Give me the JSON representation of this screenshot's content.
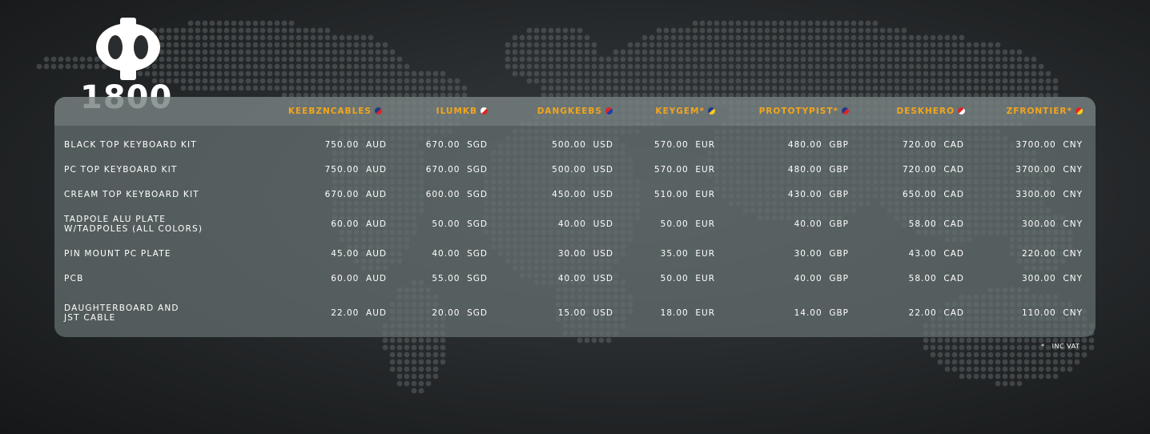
{
  "logo": {
    "symbol": "Φ",
    "model": "1800"
  },
  "vendors": [
    {
      "name": "KEEBZNCABLES",
      "flag_colors": [
        "#1e3a8a",
        "#dc2626"
      ]
    },
    {
      "name": "ILUMKB",
      "flag_colors": [
        "#ffffff",
        "#dc2626"
      ]
    },
    {
      "name": "DANGKEEBS",
      "flag_colors": [
        "#dc2626",
        "#1e40af"
      ]
    },
    {
      "name": "KEYGEM*",
      "flag_colors": [
        "#1e3a8a",
        "#facc15"
      ]
    },
    {
      "name": "PROTOTYPIST*",
      "flag_colors": [
        "#1e3a8a",
        "#dc2626"
      ]
    },
    {
      "name": "DESKHERO",
      "flag_colors": [
        "#dc2626",
        "#ffffff"
      ]
    },
    {
      "name": "ZFRONTIER*",
      "flag_colors": [
        "#dc2626",
        "#facc15"
      ]
    }
  ],
  "rows": [
    {
      "label": "BLACK TOP KEYBOARD KIT",
      "prices": [
        "750.00  AUD",
        "670.00  SGD",
        "500.00  USD",
        "570.00  EUR",
        "480.00  GBP",
        "720.00  CAD",
        "3700.00  CNY"
      ]
    },
    {
      "label": "PC TOP KEYBOARD KIT",
      "prices": [
        "750.00  AUD",
        "670.00  SGD",
        "500.00  USD",
        "570.00  EUR",
        "480.00  GBP",
        "720.00  CAD",
        "3700.00  CNY"
      ]
    },
    {
      "label": "CREAM TOP KEYBOARD KIT",
      "prices": [
        "670.00  AUD",
        "600.00  SGD",
        "450.00  USD",
        "510.00  EUR",
        "430.00  GBP",
        "650.00  CAD",
        "3300.00  CNY"
      ]
    },
    {
      "label": "TADPOLE ALU PLATE\nW/TADPOLES (ALL COLORS)",
      "prices": [
        "60.00  AUD",
        "50.00  SGD",
        "40.00  USD",
        "50.00  EUR",
        "40.00  GBP",
        "58.00  CAD",
        "300.00  CNY"
      ]
    },
    {
      "label": "PIN MOUNT PC PLATE",
      "prices": [
        "45.00  AUD",
        "40.00  SGD",
        "30.00  USD",
        "35.00  EUR",
        "30.00  GBP",
        "43.00  CAD",
        "220.00  CNY"
      ]
    },
    {
      "label": "PCB",
      "prices": [
        "60.00  AUD",
        "55.00  SGD",
        "40.00  USD",
        "50.00  EUR",
        "40.00  GBP",
        "58.00  CAD",
        "300.00  CNY"
      ]
    },
    {
      "label": "DAUGHTERBOARD AND\nJST CABLE",
      "prices": [
        "22.00  AUD",
        "20.00  SGD",
        "15.00  USD",
        "18.00  EUR",
        "14.00  GBP",
        "22.00  CAD",
        "110.00  CNY"
      ]
    }
  ],
  "footnote": "*   INC VAT"
}
